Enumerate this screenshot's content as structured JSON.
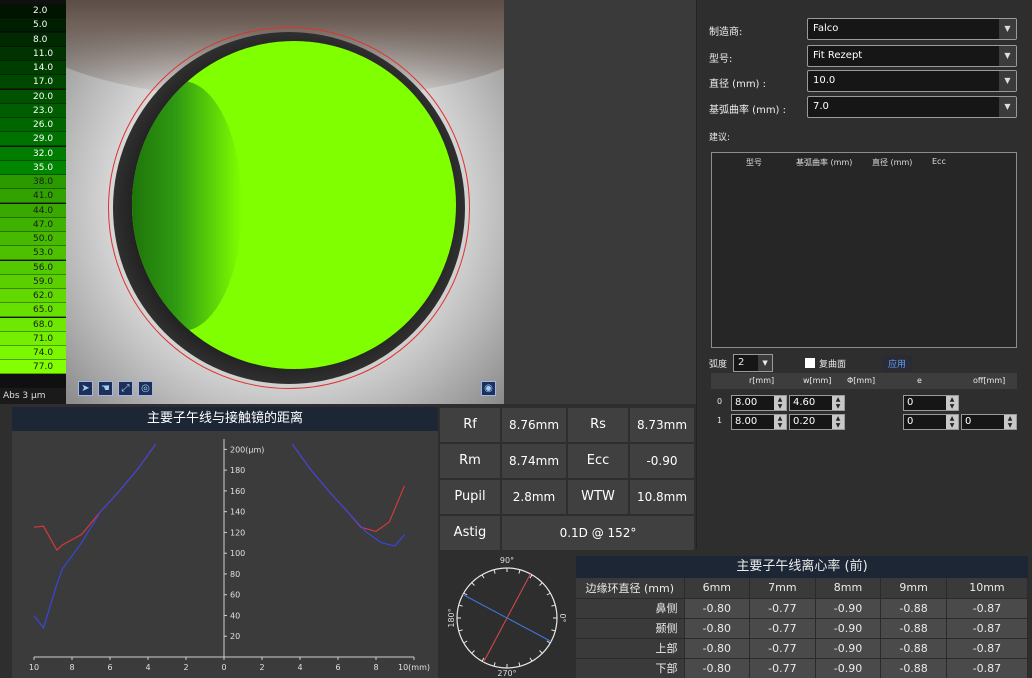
{
  "scale": {
    "values": [
      "2.0",
      "5.0",
      "8.0",
      "11.0",
      "14.0",
      "17.0",
      "20.0",
      "23.0",
      "26.0",
      "29.0",
      "32.0",
      "35.0",
      "38.0",
      "41.0",
      "44.0",
      "47.0",
      "50.0",
      "53.0",
      "56.0",
      "59.0",
      "62.0",
      "65.0",
      "68.0",
      "71.0",
      "74.0",
      "77.0"
    ],
    "abs_label": "Abs  3 μm"
  },
  "settings": {
    "manufacturer_label": "制造商:",
    "manufacturer_value": "Falco",
    "model_label": "型号:",
    "model_value": "Fit Rezept",
    "diameter_label": "直径 (mm) :",
    "diameter_value": "10.0",
    "base_curve_label": "基弧曲率 (mm) :",
    "base_curve_value": "7.0",
    "suggest_label": "建议:",
    "suggest_headers": [
      "型号",
      "基弧曲率 (mm)",
      "直径 (mm)",
      "Ecc"
    ],
    "arc_label": "弧度",
    "arc_value": "2",
    "compound_label": "复曲面",
    "apply_label": "应用",
    "param_headers": [
      "r[mm]",
      "w[mm]",
      "Φ[mm]",
      "e",
      "off[mm]"
    ],
    "param_rows": [
      {
        "idx": "0",
        "r": "8.00",
        "w": "4.60",
        "e": "0"
      },
      {
        "idx": "1",
        "r": "8.00",
        "w": "0.20",
        "e": "0",
        "off": "0"
      }
    ]
  },
  "profile_chart": {
    "title": "主要子午线与接触镜的距离"
  },
  "chart_data": {
    "type": "line",
    "title": "主要子午线与接触镜的距离",
    "xlabel": "(mm)",
    "ylabel": "(μm)",
    "x_ticks": [
      "10",
      "8",
      "6",
      "4",
      "2",
      "0",
      "2",
      "4",
      "6",
      "8",
      "10(mm)"
    ],
    "y_ticks": [
      "20",
      "40",
      "60",
      "80",
      "100",
      "120",
      "140",
      "160",
      "180",
      "200(μm)"
    ],
    "ylim": [
      0,
      210
    ],
    "series": [
      {
        "color": "#d23a3a",
        "x": [
          -10,
          -9.5,
          -8.8,
          -8.5,
          -7.5,
          -6.5,
          -5.5,
          -4.5,
          -3.6,
          3.6,
          4.5,
          5.5,
          6.5,
          7.2,
          8.0,
          8.7,
          9.5
        ],
        "y": [
          125,
          126,
          103,
          108,
          118,
          140,
          160,
          182,
          205,
          205,
          182,
          160,
          140,
          125,
          121,
          130,
          165
        ]
      },
      {
        "color": "#3846d9",
        "x": [
          -10,
          -9.5,
          -8.8,
          -8.5,
          -7.5,
          -6.5,
          -5.5,
          -4.5,
          -3.6,
          3.6,
          4.5,
          5.5,
          6.5,
          7.5,
          8.3,
          9.0,
          9.5
        ],
        "y": [
          40,
          28,
          70,
          85,
          110,
          140,
          160,
          182,
          205,
          205,
          182,
          160,
          140,
          120,
          110,
          107,
          118
        ]
      }
    ]
  },
  "values": {
    "rf_label": "Rf",
    "rf": "8.76mm",
    "rs_label": "Rs",
    "rs": "8.73mm",
    "rm_label": "Rm",
    "rm": "8.74mm",
    "ecc_label": "Ecc",
    "ecc": "-0.90",
    "pupil_label": "Pupil",
    "pupil": "2.8mm",
    "wtw_label": "WTW",
    "wtw": "10.8mm",
    "astig_label": "Astig",
    "astig": "0.1D @ 152°"
  },
  "dial": {
    "top": "90°",
    "bottom": "270°",
    "left": "180°",
    "right": "0°",
    "axis_deg": 152
  },
  "ecc_table": {
    "title": "主要子午线离心率 (前)",
    "headers": [
      "边缘环直径 (mm)",
      "6mm",
      "7mm",
      "8mm",
      "9mm",
      "10mm"
    ],
    "rows": [
      [
        "鼻侧",
        "-0.80",
        "-0.77",
        "-0.90",
        "-0.88",
        "-0.87"
      ],
      [
        "颞侧",
        "-0.80",
        "-0.77",
        "-0.90",
        "-0.88",
        "-0.87"
      ],
      [
        "上部",
        "-0.80",
        "-0.77",
        "-0.90",
        "-0.88",
        "-0.87"
      ],
      [
        "下部",
        "-0.80",
        "-0.77",
        "-0.90",
        "-0.88",
        "-0.87"
      ]
    ]
  },
  "colors": {
    "accent": "#80ff00",
    "header_bg": "#1d2634",
    "apply_link": "#5a9bff"
  }
}
